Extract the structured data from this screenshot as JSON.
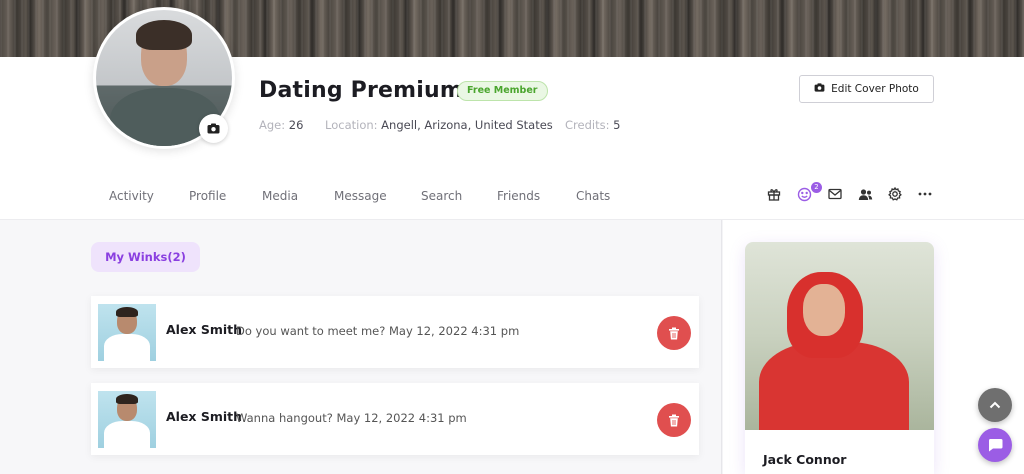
{
  "profile": {
    "name": "Dating Premium",
    "badge": "Free Member",
    "age_label": "Age:",
    "age_value": "26",
    "location_label": "Location:",
    "location_value": "Angell, Arizona, United States",
    "credits_label": "Credits:",
    "credits_value": "5"
  },
  "header": {
    "edit_cover_label": "Edit Cover Photo"
  },
  "tabs": [
    "Activity",
    "Profile",
    "Media",
    "Message",
    "Search",
    "Friends",
    "Chats"
  ],
  "toolbar": {
    "icons": [
      "gift-icon",
      "smiley-icon",
      "mail-icon",
      "users-icon",
      "gear-icon",
      "more-icon"
    ],
    "notification_count": "2"
  },
  "winks": {
    "title": "My Winks(2)",
    "items": [
      {
        "name": "Alex Smith",
        "message": "Do you want to meet me? May 12, 2022 4:31 pm"
      },
      {
        "name": "Alex Smith",
        "message": "Wanna hangout? May 12, 2022 4:31 pm"
      }
    ]
  },
  "sidebar": {
    "member_name": "Jack Connor"
  },
  "colors": {
    "accent": "#9b5de5",
    "delete": "#e04f4f",
    "badge_green": "#4aa52e"
  }
}
